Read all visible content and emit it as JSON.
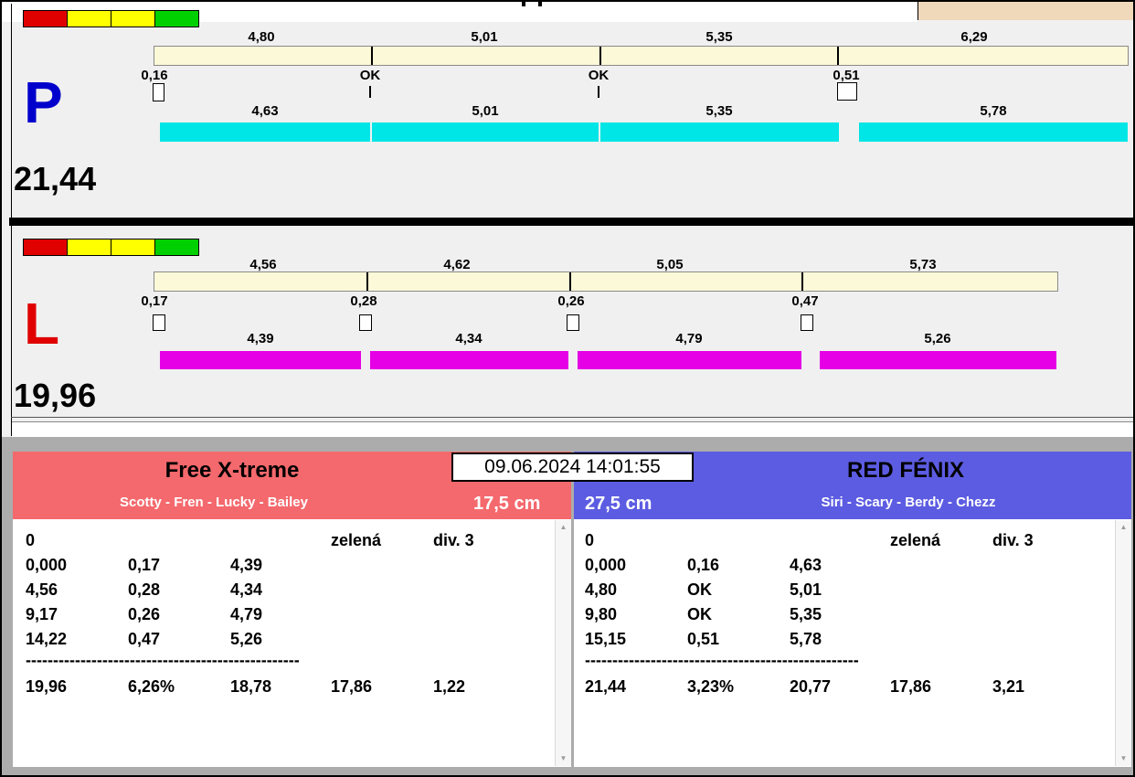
{
  "colors": {
    "traffic_red": "#e10000",
    "traffic_yellow": "#ffff00",
    "traffic_green": "#00d000",
    "p_letter": "#0000cc",
    "l_letter": "#e00000",
    "scale_bar": "#fcf9d8",
    "p_segments": "#00e5e5",
    "l_segments": "#e500e5",
    "left_header": "#f4696d",
    "right_header": "#5c5ce2"
  },
  "datetime": "09.06.2024 14:01:55",
  "lane_p": {
    "letter": "P",
    "total": "21,44",
    "scale_labels": [
      "4,80",
      "5,01",
      "5,35",
      "6,29"
    ],
    "mark_labels": [
      "0,16",
      "OK",
      "OK",
      "0,51"
    ],
    "segment_labels": [
      "4,63",
      "5,01",
      "5,35",
      "5,78"
    ]
  },
  "lane_l": {
    "letter": "L",
    "total": "19,96",
    "scale_labels": [
      "4,56",
      "4,62",
      "5,05",
      "5,73"
    ],
    "mark_labels": [
      "0,17",
      "0,28",
      "0,26",
      "0,47"
    ],
    "segment_labels": [
      "4,39",
      "4,34",
      "4,79",
      "5,26"
    ]
  },
  "teams": {
    "left": {
      "name": "Free X-treme",
      "dogs": "Scotty - Fren - Lucky - Bailey",
      "jump_height": "17,5 cm",
      "table": {
        "penalties": "0",
        "color_label": "zelená",
        "division": "div. 3",
        "rows": [
          [
            "0,000",
            "0,17",
            "4,39"
          ],
          [
            "4,56",
            "0,28",
            "4,34"
          ],
          [
            "9,17",
            "0,26",
            "4,79"
          ],
          [
            "14,22",
            "0,47",
            "5,26"
          ]
        ],
        "divider": "--------------------------------------------------",
        "summary": [
          "19,96",
          "6,26%",
          "18,78",
          "17,86",
          "1,22"
        ]
      }
    },
    "right": {
      "name": "RED FÉNIX",
      "dogs": "Siri - Scary - Berdy - Chezz",
      "jump_height": "27,5 cm",
      "table": {
        "penalties": "0",
        "color_label": "zelená",
        "division": "div. 3",
        "rows": [
          [
            "0,000",
            "0,16",
            "4,63"
          ],
          [
            "4,80",
            "OK",
            "5,01"
          ],
          [
            "9,80",
            "OK",
            "5,35"
          ],
          [
            "15,15",
            "0,51",
            "5,78"
          ]
        ],
        "divider": "--------------------------------------------------",
        "summary": [
          "21,44",
          "3,23%",
          "20,77",
          "17,86",
          "3,21"
        ]
      }
    }
  }
}
